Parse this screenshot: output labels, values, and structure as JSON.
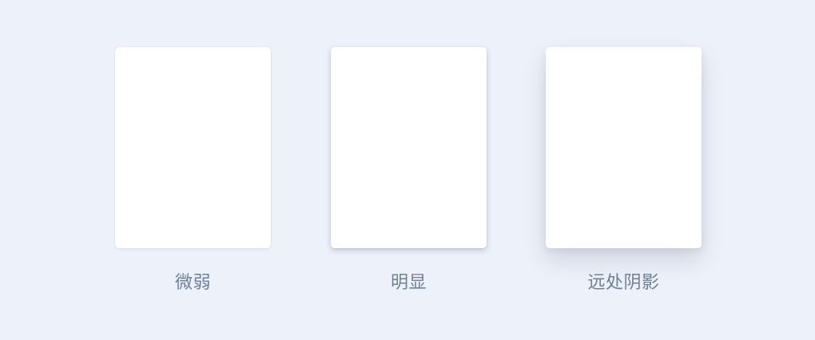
{
  "cards": [
    {
      "label": "微弱"
    },
    {
      "label": "明显"
    },
    {
      "label": "远处阴影"
    }
  ],
  "colors": {
    "background": "#edf1f9",
    "card": "#ffffff",
    "label": "#6e7f98"
  }
}
